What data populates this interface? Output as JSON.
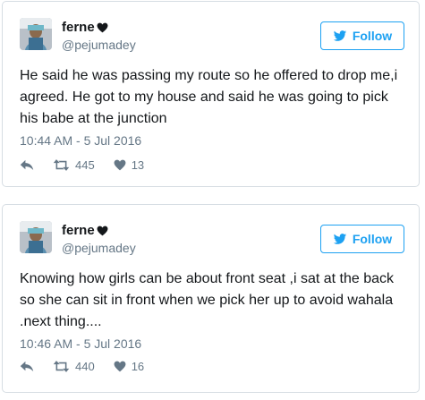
{
  "tweets": [
    {
      "display_name": "ferne",
      "handle": "@pejumadey",
      "follow_label": "Follow",
      "text": "He said he was passing my route so he offered to drop me,i agreed. He got to my house and said he was going to pick his babe at the junction",
      "timestamp": "10:44 AM - 5 Jul 2016",
      "retweets": "445",
      "likes": "13"
    },
    {
      "display_name": "ferne",
      "handle": "@pejumadey",
      "follow_label": "Follow",
      "text": "Knowing how girls can be about front seat ,i sat at the back so she can sit in front when we pick her up to avoid wahala .next thing....",
      "timestamp": "10:46 AM - 5 Jul 2016",
      "retweets": "440",
      "likes": "16"
    }
  ],
  "icons": {
    "verified_heart": "heart-icon",
    "follow": "twitter-bird-icon",
    "reply": "reply-icon",
    "retweet": "retweet-icon",
    "like": "like-icon"
  },
  "colors": {
    "accent": "#1da1f2",
    "text": "#14171a",
    "muted": "#657786",
    "border": "#d6dde3"
  }
}
